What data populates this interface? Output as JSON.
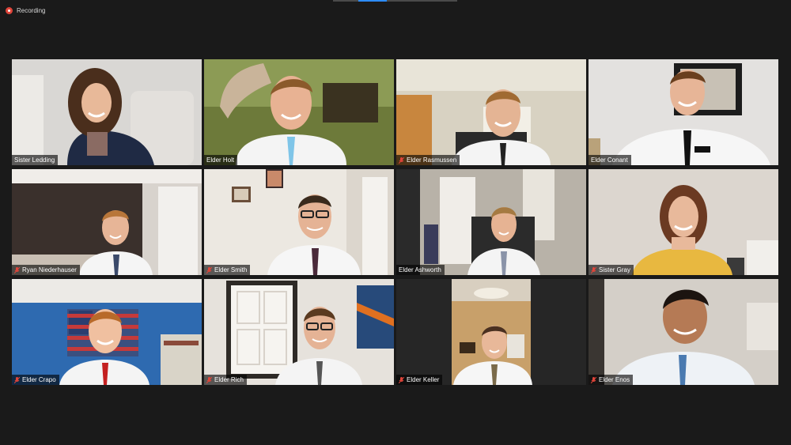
{
  "recording": {
    "label": "Recording"
  },
  "participants": [
    {
      "name": "Sister Ledding",
      "muted": false,
      "active": false
    },
    {
      "name": "Elder Holt",
      "muted": false,
      "active": false
    },
    {
      "name": "Elder Rasmussen",
      "muted": true,
      "active": false
    },
    {
      "name": "Elder Conant",
      "muted": false,
      "active": true
    },
    {
      "name": "Ryan Niederhauser",
      "muted": true,
      "active": false
    },
    {
      "name": "Elder Smith",
      "muted": true,
      "active": false
    },
    {
      "name": "Elder Ashworth",
      "muted": false,
      "active": false
    },
    {
      "name": "Sister Gray",
      "muted": true,
      "active": false
    },
    {
      "name": "Elder Crapo",
      "muted": true,
      "active": false
    },
    {
      "name": "Elder Rich",
      "muted": true,
      "active": false
    },
    {
      "name": "Elder Keller",
      "muted": true,
      "active": false
    },
    {
      "name": "Elder Enos",
      "muted": true,
      "active": false
    }
  ],
  "colors": {
    "background": "#1a1a1a",
    "active_speaker_border": "#c7e34a",
    "muted_icon": "#e0453a",
    "recording_dot": "#e0453a"
  }
}
